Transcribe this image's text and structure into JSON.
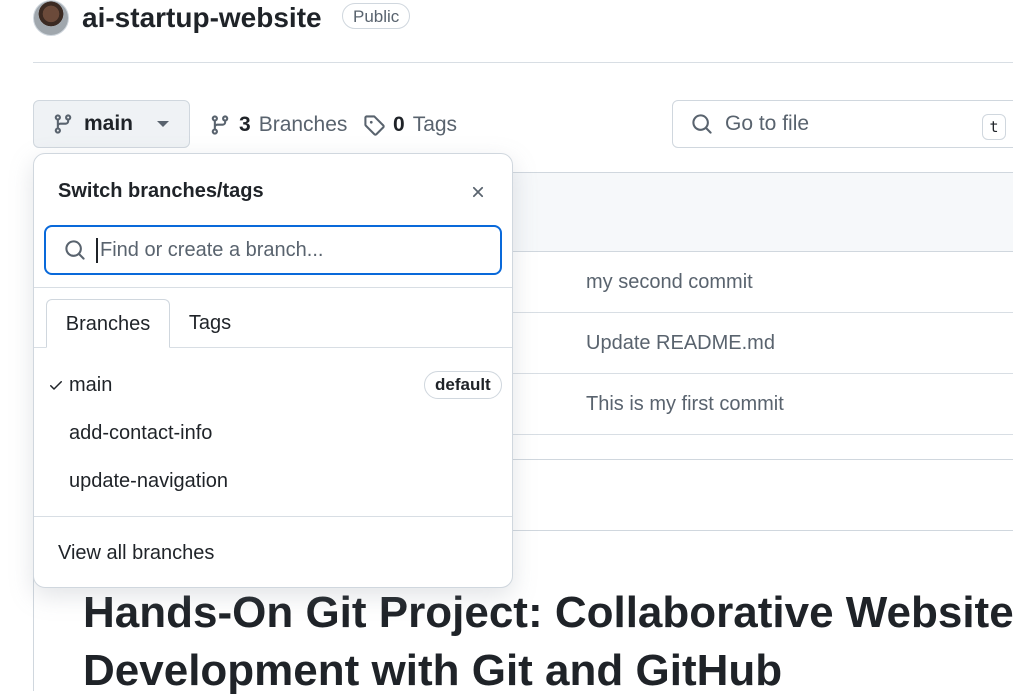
{
  "repo": {
    "name": "ai-startup-website",
    "visibility": "Public"
  },
  "toolbar": {
    "current_branch": "main",
    "branches_count": "3",
    "branches_label": "Branches",
    "tags_count": "0",
    "tags_label": "Tags",
    "goto_placeholder": "Go to file",
    "goto_shortcut": "t"
  },
  "file_table": {
    "commits": [
      "my second commit",
      "Update README.md",
      "This is my first commit"
    ]
  },
  "readme": {
    "heading_line1": "Hands-On Git Project: Collaborative Website",
    "heading_line2": "Development with Git and GitHub"
  },
  "dropdown": {
    "title": "Switch branches/tags",
    "search_placeholder": "Find or create a branch...",
    "tabs": [
      "Branches",
      "Tags"
    ],
    "branches": [
      {
        "name": "main",
        "checked": true,
        "badge": "default"
      },
      {
        "name": "add-contact-info",
        "checked": false
      },
      {
        "name": "update-navigation",
        "checked": false
      }
    ],
    "view_all": "View all branches"
  },
  "colors": {
    "accent": "#0969da",
    "text": "#1f2328",
    "muted": "#59636e",
    "border": "#d0d7de"
  }
}
